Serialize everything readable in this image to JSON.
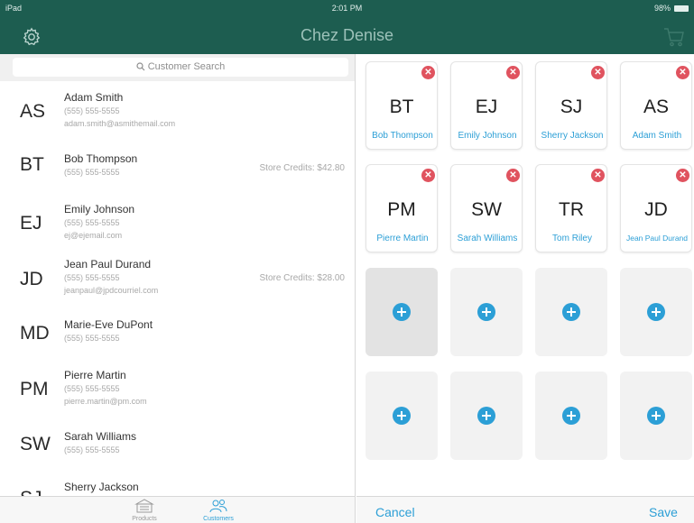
{
  "status_bar": {
    "device": "iPad",
    "time": "2:01 PM",
    "battery": "98%"
  },
  "nav": {
    "title": "Chez Denise",
    "icons": [
      "gear-icon",
      "cart-icon"
    ]
  },
  "search": {
    "placeholder": "Customer Search"
  },
  "customers": [
    {
      "initials": "AS",
      "name": "Adam Smith",
      "phone": "(555) 555-5555",
      "email": "adam.smith@asmithemail.com",
      "credit": ""
    },
    {
      "initials": "BT",
      "name": "Bob Thompson",
      "phone": "(555) 555-5555",
      "email": "",
      "credit": "Store Credits: $42.80"
    },
    {
      "initials": "EJ",
      "name": "Emily Johnson",
      "phone": "(555) 555-5555",
      "email": "ej@ejemail.com",
      "credit": ""
    },
    {
      "initials": "JD",
      "name": "Jean Paul Durand",
      "phone": "(555) 555-5555",
      "email": "jeanpaul@jpdcourriel.com",
      "credit": "Store Credits: $28.00"
    },
    {
      "initials": "MD",
      "name": "Marie-Eve DuPont",
      "phone": "(555) 555-5555",
      "email": "",
      "credit": ""
    },
    {
      "initials": "PM",
      "name": "Pierre Martin",
      "phone": "(555) 555-5555",
      "email": "pierre.martin@pm.com",
      "credit": ""
    },
    {
      "initials": "SW",
      "name": "Sarah Williams",
      "phone": "(555) 555-5555",
      "email": "",
      "credit": ""
    },
    {
      "initials": "SJ",
      "name": "Sherry Jackson",
      "phone": "",
      "email": "",
      "credit": ""
    }
  ],
  "favorites": [
    {
      "initials": "BT",
      "name": "Bob Thompson"
    },
    {
      "initials": "EJ",
      "name": "Emily Johnson"
    },
    {
      "initials": "SJ",
      "name": "Sherry Jackson"
    },
    {
      "initials": "AS",
      "name": "Adam Smith"
    },
    {
      "initials": "PM",
      "name": "Pierre Martin"
    },
    {
      "initials": "SW",
      "name": "Sarah Williams"
    },
    {
      "initials": "TR",
      "name": "Tom Riley"
    },
    {
      "initials": "JD",
      "name": "Jean Paul Durand"
    }
  ],
  "empty_slot_count": 8,
  "tabs": [
    {
      "label": "Products",
      "icon": "store-icon",
      "active": false
    },
    {
      "label": "Customers",
      "icon": "customers-icon",
      "active": true
    }
  ],
  "actions": {
    "cancel": "Cancel",
    "save": "Save"
  },
  "colors": {
    "nav_bg": "#1d5d50",
    "accent": "#2c9fd6",
    "remove": "#e0535f"
  }
}
